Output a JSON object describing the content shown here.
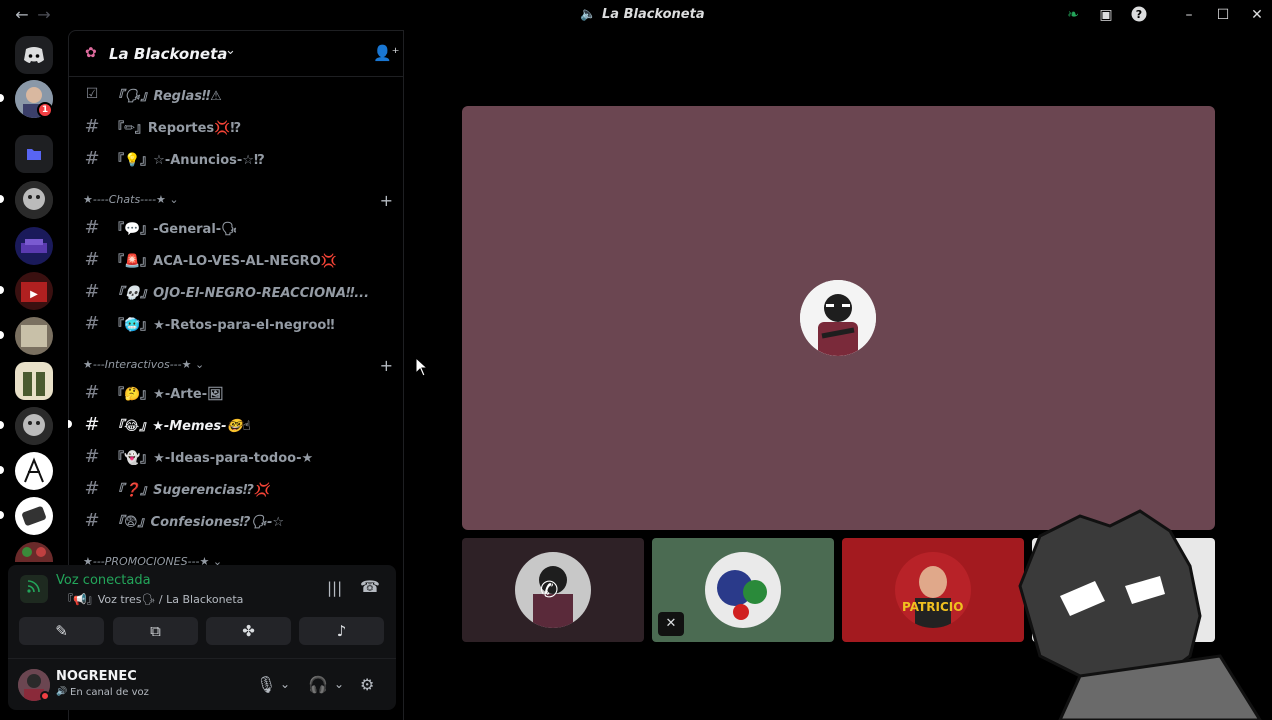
{
  "window": {
    "title": "La Blackoneta",
    "back_icon": "arrow-left-icon",
    "forward_icon": "arrow-right-icon"
  },
  "rail": {
    "notification_count": "1"
  },
  "guild": {
    "name": "La Blackoneta"
  },
  "channels_top": [
    {
      "label": "『🗣』Reglas‼⚠",
      "icon": "rules-icon"
    },
    {
      "label": "『✏』Reportes💢⁉",
      "icon": "hash-icon"
    },
    {
      "label": "『💡』☆-Anuncios-☆⁉",
      "icon": "hash-icon"
    }
  ],
  "categories": [
    {
      "label": "★----Chats----★ ⌄"
    },
    {
      "label": "★---Interactivos---★ ⌄"
    },
    {
      "label": "★---PROMOCIONES---★ ⌄"
    }
  ],
  "channels_chats": [
    {
      "label": "『💬』-General-🗣"
    },
    {
      "label": "『🚨』ACA-LO-VES-AL-NEGRO💢"
    },
    {
      "label": "『💀』OJO-El-NEGRO-REACCIONA‼..."
    },
    {
      "label": "『🥶』★-Retos-para-el-negroo‼"
    }
  ],
  "channels_interactivos": [
    {
      "label": "『🤔』★-Arte-🖼"
    },
    {
      "label": "『😂』★-Memes-🤓☝"
    },
    {
      "label": "『👻』★-Ideas-para-todoo-★"
    },
    {
      "label": "『❓』Sugerencias⁉💢"
    },
    {
      "label": "『😨』Confesiones⁉🗣-☆"
    }
  ],
  "voice": {
    "status": "Voz conectada",
    "channel": "『📢』Voz tres🗣 / La Blackoneta"
  },
  "user": {
    "name": "NOGRENEC",
    "status": "En canal de voz"
  },
  "colors": {
    "stage_bg": "#6b4651",
    "tile1_bg": "#2e2126",
    "tile2_bg": "#4b6b52",
    "tile3_bg": "#a31a1f",
    "connected_green": "#23a55a"
  },
  "tiles": [
    {
      "name": "tile-1",
      "icon": "phone-icon"
    },
    {
      "name": "tile-2",
      "icon": "muted-mic-icon"
    },
    {
      "name": "tile-3",
      "label": "PATRICIO"
    }
  ]
}
